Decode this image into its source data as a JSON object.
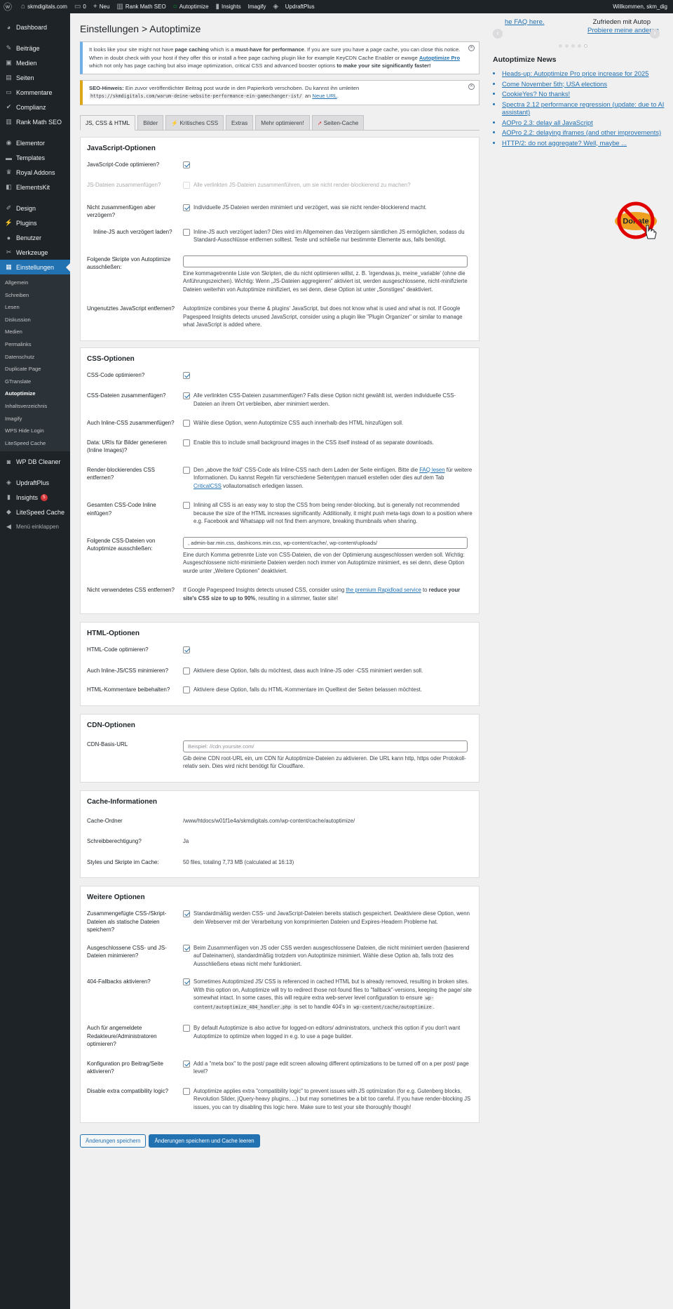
{
  "adminbar": {
    "site": "skmdigitals.com",
    "comments": "0",
    "new": "Neu",
    "rankmath": "Rank Math SEO",
    "autoptimize": "Autoptimize",
    "insights": "Insights",
    "imagify": "Imagify",
    "updraft": "UpdraftPlus",
    "welcome": "Willkommen, skm_dig"
  },
  "sidebar": {
    "dashboard": "Dashboard",
    "beitraege": "Beiträge",
    "medien": "Medien",
    "seiten": "Seiten",
    "kommentare": "Kommentare",
    "complianz": "Complianz",
    "rankmath": "Rank Math SEO",
    "elementor": "Elementor",
    "templates": "Templates",
    "royal": "Royal Addons",
    "elementskit": "ElementsKit",
    "design": "Design",
    "plugins": "Plugins",
    "benutzer": "Benutzer",
    "werkzeuge": "Werkzeuge",
    "einstellungen": "Einstellungen",
    "sub": [
      "Allgemein",
      "Schreiben",
      "Lesen",
      "Diskussion",
      "Medien",
      "Permalinks",
      "Datenschutz",
      "Duplicate Page",
      "GTranslate",
      "Autoptimize",
      "Inhaltsverzeichnis",
      "Imagify",
      "WPS Hide Login",
      "LiteSpeed Cache"
    ],
    "wpdb": "WP DB Cleaner",
    "updraft": "UpdraftPlus",
    "insights": "Insights",
    "insights_badge": "5",
    "litespeed": "LiteSpeed Cache",
    "collapse": "Menü einklappen"
  },
  "page": {
    "title": "Einstellungen > Autoptimize",
    "notice1": {
      "p1a": "It looks like your site might not have ",
      "p1b": "page caching",
      "p1c": " which is a ",
      "p1d": "must-have for performance",
      "p1e": ". If you are sure you have a page cache, you can close this notice.",
      "p2a": "When in doubt check with your host if they offer this or install a free page caching plugin like for example KeyCDN Cache Enabler or ewwge ",
      "p2link": "Autoptimize Pro",
      "p2b": " which not only has page caching but also image optimization, critical CSS and advanced booster options ",
      "p2c": "to make your site significantly faster",
      "p2d": "!"
    },
    "notice2": {
      "label": "SEO-Hinweis:",
      "text": " Ein zuvor veröffentlichter Beitrag post wurde in den Papierkorb verschoben. Du kannst ihn umleiten",
      "code": "https://skmdigitals.com/warum-deine-website-performance-ein-gamechanger-ist/",
      "an": " an ",
      "link": "Neue URL",
      "dot": "."
    },
    "tabs": [
      "JS, CSS & HTML",
      "Bilder",
      "Kritisches CSS",
      "Extras",
      "Mehr optimieren!",
      "Seiten-Cache"
    ]
  },
  "js": {
    "heading": "JavaScript-Optionen",
    "r1_label": "JavaScript-Code optimieren?",
    "r2_label": "JS-Dateien zusammenfügen?",
    "r2_text": "Alle verlinkten JS-Dateien zusammenführen, um sie nicht render-blockierend zu machen?",
    "r3_label": "Nicht zusammenfügen aber verzögern?",
    "r3_text": "Individuelle JS-Dateien werden minimiert und verzögert, was sie nicht render-blockierend macht.",
    "r4_label": "Inline-JS auch verzögert laden?",
    "r4_text": "Inline-JS auch verzögert laden? Dies wird im Allgemeinen das Verzögern sämtlichen JS ermöglichen, sodass du Standard-Ausschlüsse entfernen solltest. Teste und schließe nur bestimmte Elemente aus, falls benötigt.",
    "r5_label": "Folgende Skripte von Autoptimize ausschließen:",
    "r5_value": "",
    "r5_text": "Eine kommagetrennte Liste von Skripten, die du nicht optimieren willst, z. B. 'irgendwas.js, meine_variable' (ohne die Anführungszeichen). Wichtig: Wenn „JS-Dateien aggregieren\" aktiviert ist, werden ausgeschlossene, nicht-minifizierte Dateien weiterhin von Autoptimize minifiziert, es sei denn, diese Option ist unter „Sonstiges\" deaktiviert.",
    "r6_label": "Ungenutztes JavaScript entfernen?",
    "r6_text": "Autoptimize combines your theme & plugins' JavaScript, but does not know what is used and what is not. If Google Pagespeed Insights detects unused JavaScript, consider using a plugin like \"Plugin Organizer\" or similar to manage what JavaScript is added where."
  },
  "css": {
    "heading": "CSS-Optionen",
    "r1_label": "CSS-Code optimieren?",
    "r2_label": "CSS-Dateien zusammenfügen?",
    "r2_text": "Alle verlinkten CSS-Dateien zusammenfügen? Falls diese Option nicht gewählt ist, werden individuelle CSS-Dateien an ihrem Ort verbleiben, aber minimiert werden.",
    "r3_label": "Auch Inline-CSS zusammenfügen?",
    "r3_text": "Wähle diese Option, wenn Autoptimize CSS auch innerhalb des HTML hinzufügen soll.",
    "r4_label": "Data: URIs für Bilder generieren (Inline Images)?",
    "r4_text": "Enable this to include small background images in the CSS itself instead of as separate downloads.",
    "r5_label": "Render-blockierendes CSS entfernen?",
    "r5_a": "Den „above the fold\" CSS-Code als Inline-CSS nach dem Laden der Seite einfügen. Bitte die ",
    "r5_link1": "FAQ lesen",
    "r5_b": " für weitere Informationen. Du kannst Regeln für verschiedene Seitentypen manuell erstellen oder dies auf dem Tab ",
    "r5_link2": "CriticalCSS",
    "r5_c": " vollautomatisch erledigen lassen.",
    "r6_label": "Gesamten CSS-Code Inline einfügen?",
    "r6_text": "Inlining all CSS is an easy way to stop the CSS from being render-blocking, but is generally not recommended because the size of the HTML increases significantly. Additionally, it might push meta-tags down to a position where e.g. Facebook and Whatsapp will not find them anymore, breaking thumbnails when sharing.",
    "r7_label": "Folgende CSS-Dateien von Autoptimize ausschließen:",
    "r7_value": ", admin-bar.min.css, dashicons.min.css, wp-content/cache/, wp-content/uploads/",
    "r7_text": "Eine durch Komma getrennte Liste von CSS-Dateien, die von der Optimierung ausgeschlossen werden soll. Wichtig: Ausgeschlossene nicht-minimierte Dateien werden noch immer von Autoptimize minimiert, es sei denn, diese Option wurde unter „Weitere Optionen\" deaktiviert.",
    "r8_label": "Nicht verwendetes CSS entfernen?",
    "r8_a": "If Google Pagespeed Insights detects unused CSS, consider using ",
    "r8_link": "the premium Rapidload service",
    "r8_b": " to ",
    "r8_c": "reduce your site's CSS size to up to 90%",
    "r8_d": ", resulting in a slimmer, faster site!"
  },
  "html": {
    "heading": "HTML-Optionen",
    "r1_label": "HTML-Code optimieren?",
    "r2_label": "Auch Inline-JS/CSS minimieren?",
    "r2_text": "Aktiviere diese Option, falls du möchtest, dass auch Inline-JS oder -CSS minimiert werden soll.",
    "r3_label": "HTML-Kommentare beibehalten?",
    "r3_text": "Aktiviere diese Option, falls du HTML-Kommentare im Quelltext der Seiten belassen möchtest."
  },
  "cdn": {
    "heading": "CDN-Optionen",
    "r1_label": "CDN-Basis-URL",
    "r1_placeholder": "Beispiel: //cdn.yoursite.com/",
    "r1_text": "Gib deine CDN root-URL ein, um CDN für Autoptimize-Dateien zu aktivieren. Die URL kann http, https oder Protokoll-relativ sein. Dies wird nicht benötigt für Cloudflare."
  },
  "cache": {
    "heading": "Cache-Informationen",
    "r1_label": "Cache-Ordner",
    "r1_value": "/www/htdocs/w01f1e4a/skmdigitals.com/wp-content/cache/autoptimize/",
    "r2_label": "Schreibberechtigung?",
    "r2_value": "Ja",
    "r3_label": "Styles und Skripte im Cache:",
    "r3_value": "50 files, totaling 7,73 MB (calculated at 16:13)"
  },
  "more": {
    "heading": "Weitere Optionen",
    "r1_label": "Zusammengefügte CSS-/Skript-Dateien als statische Dateien speichern?",
    "r1_text": "Standardmäßig werden CSS- und JavaScript-Dateien bereits statisch gespeichert. Deaktiviere diese Option, wenn dein Webserver mit der Verarbeitung von komprimierten Dateien und Expires-Headern Probleme hat.",
    "r2_label": "Ausgeschlossene CSS- und JS-Dateien minimieren?",
    "r2_text": "Beim Zusammenfügen von JS oder CSS werden ausgeschlossene Dateien, die nicht minimiert werden (basierend auf Dateinamen), standardmäßig trotzdem von Autoptimize minimiert. Wähle diese Option ab, falls trotz des Ausschließens etwas nicht mehr funktioniert.",
    "r3_label": "404-Fallbacks aktivieren?",
    "r3_a": "Sometimes Autoptimized JS/ CSS is referenced in cached HTML but is already removed, resulting in broken sites. With this option on, Autoptimize will try to redirect those not-found files to \"fallback\"-versions, keeping the page/ site somewhat intact. In some cases, this will require extra web-server level configuration to ensure ",
    "r3_code1": "wp-content/autoptimize_404_handler.php",
    "r3_b": " is set to handle 404's in ",
    "r3_code2": "wp-content/cache/autoptimize",
    "r3_c": ".",
    "r4_label": "Auch für angemeldete Redakteure/Administratoren optimieren?",
    "r4_text": "By default Autoptimize is also active for logged-on editors/ administrators, uncheck this option if you don't want Autoptimize to optimize when logged in e.g. to use a page builder.",
    "r5_label": "Konfiguration pro Beitrag/Seite aktivieren?",
    "r5_text": "Add a \"meta box\" to the post/ page edit screen allowing different optimizations to be turned off on a per post/ page level?",
    "r6_label": "Disable extra compatibility logic?",
    "r6_text": "Autoptimize applies extra \"compatibility logic\" to prevent issues with JS optimization (for e.g. Gutenberg blocks, Revolution Slider, jQuery-heavy plugins, ...) but may sometimes be a bit too careful. If you have render-blocking JS issues, you can try disabling this logic here. Make sure to test your site thoroughly though!"
  },
  "buttons": {
    "save": "Änderungen speichern",
    "save_clear": "Änderungen speichern und Cache leeren"
  },
  "right": {
    "carousel_left": "he FAQ here.",
    "carousel_right1": "Zufrieden mit Autop",
    "carousel_right2": "Probiere meine anderen",
    "news_title": "Autoptimize News",
    "news": [
      "Heads-up: Autoptimize Pro price increase for 2025",
      "Come November 5th; USA elections",
      "CookieYes? No thanks!",
      "Spectra 2.12 performance regression (update: due to AI assistant)",
      "AOPro 2.3: delay all JavaScript",
      "AOPro 2.2: delaying iframes (and other improvements)",
      "HTTP/2: do not aggregate? Well, maybe ..."
    ],
    "donate": "Donate"
  }
}
